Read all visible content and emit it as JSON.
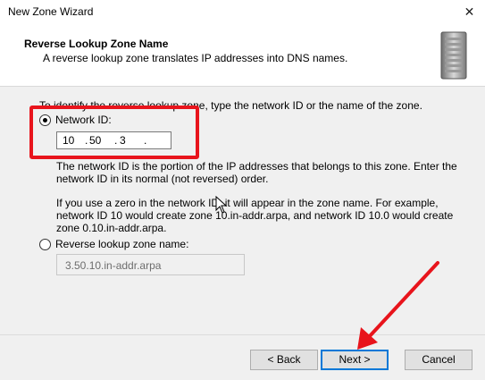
{
  "window": {
    "title": "New Zone Wizard",
    "close_glyph": "✕"
  },
  "header": {
    "title": "Reverse Lookup Zone Name",
    "subtitle": "A reverse lookup zone translates IP addresses into DNS names.",
    "icon": "server-icon"
  },
  "content": {
    "intro": "To identify the reverse lookup zone, type the network ID or the name of the zone.",
    "network_id": {
      "label": "Network ID:",
      "selected": true,
      "octets": [
        "10",
        "50",
        "3",
        ""
      ]
    },
    "network_id_help": [
      "The network ID is the portion of the IP addresses that belongs to this zone. Enter the",
      "network ID in its normal (not reversed) order."
    ],
    "zero_help": [
      "If you use a zero in the network ID, it will appear in the zone name. For example,",
      "network ID 10 would create zone 10.in-addr.arpa, and network ID 10.0 would create",
      "zone 0.10.in-addr.arpa."
    ],
    "reverse_zone": {
      "label": "Reverse lookup zone name:",
      "selected": false,
      "value": "3.50.10.in-addr.arpa"
    }
  },
  "buttons": {
    "back": "< Back",
    "next": "Next >",
    "cancel": "Cancel"
  },
  "colors": {
    "annotation": "#e8141c",
    "focus": "#0078d7",
    "panel": "#f0f0f0"
  }
}
